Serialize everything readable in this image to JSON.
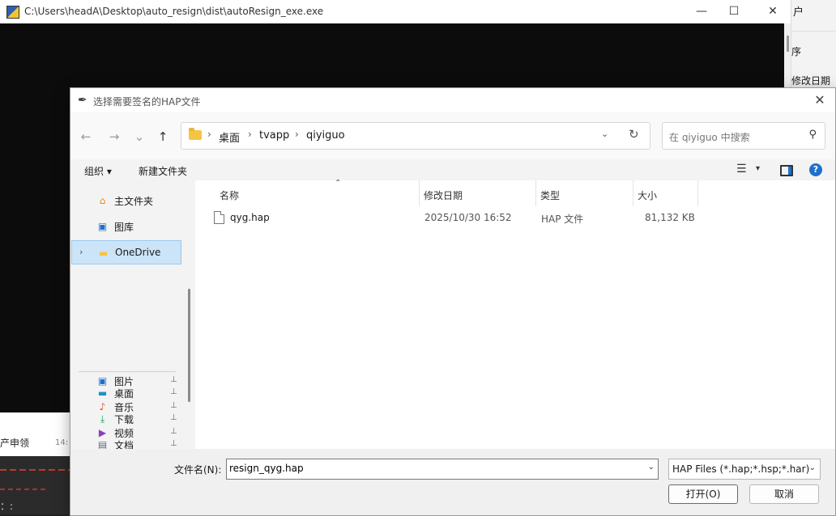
{
  "background_right": {
    "text1": "户",
    "text2": "序",
    "text3": "修改日期"
  },
  "background_bottom": {
    "text1": "产申领",
    "text2": "14:",
    "text3": "：:"
  },
  "console": {
    "title": "C:\\Users\\headA\\Desktop\\auto_resign\\dist\\autoResign_exe.exe",
    "minimize_glyph": "—",
    "maximize_glyph": "☐",
    "close_glyph": "✕"
  },
  "dialog": {
    "title": "选择需要签名的HAP文件",
    "close_glyph": "✕",
    "nav": {
      "back_glyph": "←",
      "forward_glyph": "→",
      "recent_glyph": "⌄",
      "up_glyph": "↑"
    },
    "address": {
      "crumbs": [
        "桌面",
        "tvapp",
        "qiyiguo"
      ],
      "sep_glyph": "›",
      "dropdown_glyph": "⌄",
      "refresh_glyph": "↻"
    },
    "search": {
      "placeholder": "在 qiyiguo 中搜索",
      "icon": "⚲"
    },
    "toolbar": {
      "organize": "组织 ▾",
      "new_folder": "新建文件夹",
      "view_glyph": "☰",
      "view_dd": "▾",
      "help": "?"
    },
    "sidebar": {
      "items": [
        {
          "label": "主文件夹",
          "icon": "⌂",
          "color": "#e08a1e",
          "pinned": false
        },
        {
          "label": "图库",
          "icon": "▣",
          "color": "#1e70cd",
          "pinned": false
        },
        {
          "label": "OneDrive",
          "icon": "▬",
          "color": "#f5c542",
          "pinned": false,
          "selected": true
        },
        {
          "label": "桌面",
          "icon": "▬",
          "color": "#1e90c8",
          "pinned": true
        },
        {
          "label": "下载",
          "icon": "⤓",
          "color": "#1a9a5e",
          "pinned": true
        },
        {
          "label": "文档",
          "icon": "▤",
          "color": "#5a6b7b",
          "pinned": true
        },
        {
          "label": "图片",
          "icon": "▣",
          "color": "#1e70cd",
          "pinned": true
        },
        {
          "label": "音乐",
          "icon": "♪",
          "color": "#e0542e",
          "pinned": true
        },
        {
          "label": "视频",
          "icon": "▶",
          "color": "#8a3fbf",
          "pinned": true
        }
      ],
      "pin_glyph": "📌",
      "expand_glyph": "›"
    },
    "columns": {
      "name": "名称",
      "date": "修改日期",
      "type": "类型",
      "size": "大小",
      "sort_glyph": "⌃"
    },
    "files": [
      {
        "name": "qyg.hap",
        "date": "2025/10/30 16:52",
        "type": "HAP 文件",
        "size": "81,132 KB"
      }
    ],
    "footer": {
      "filename_label": "文件名(N):",
      "filename_value": "resign_qyg.hap",
      "filename_dd": "⌄",
      "filter_value": "HAP Files (*.hap;*.hsp;*.har)",
      "filter_dd": "⌄",
      "open_label": "打开(O)",
      "cancel_label": "取消"
    }
  }
}
